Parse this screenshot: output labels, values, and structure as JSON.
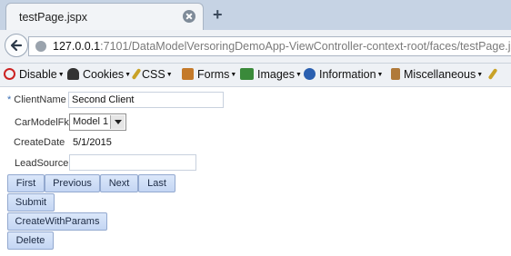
{
  "browser": {
    "tab_title": "testPage.jspx",
    "new_tab_symbol": "+",
    "url_host": "127.0.0.1",
    "url_rest": ":7101/DataModelVersoringDemoApp-ViewController-context-root/faces/testPage.jspx"
  },
  "devbar": {
    "items": [
      "Disable",
      "Cookies",
      "CSS",
      "Forms",
      "Images",
      "Information",
      "Miscellaneous"
    ],
    "colors": [
      "#cc2222",
      "#333333",
      "#c9a227",
      "#c47a2a",
      "#3a8a3a",
      "#2a5fb0",
      "#b07a3a"
    ]
  },
  "form": {
    "required_mark": "*",
    "client_name_label": "ClientName",
    "client_name_value": "Second Client",
    "car_model_label": "CarModelFk",
    "car_model_value": "Model 1",
    "create_date_label": "CreateDate",
    "create_date_value": "5/1/2015",
    "lead_source_label": "LeadSource",
    "lead_source_value": ""
  },
  "buttons": {
    "first": "First",
    "previous": "Previous",
    "next": "Next",
    "last": "Last",
    "submit": "Submit",
    "create_with_params": "CreateWithParams",
    "delete": "Delete"
  }
}
